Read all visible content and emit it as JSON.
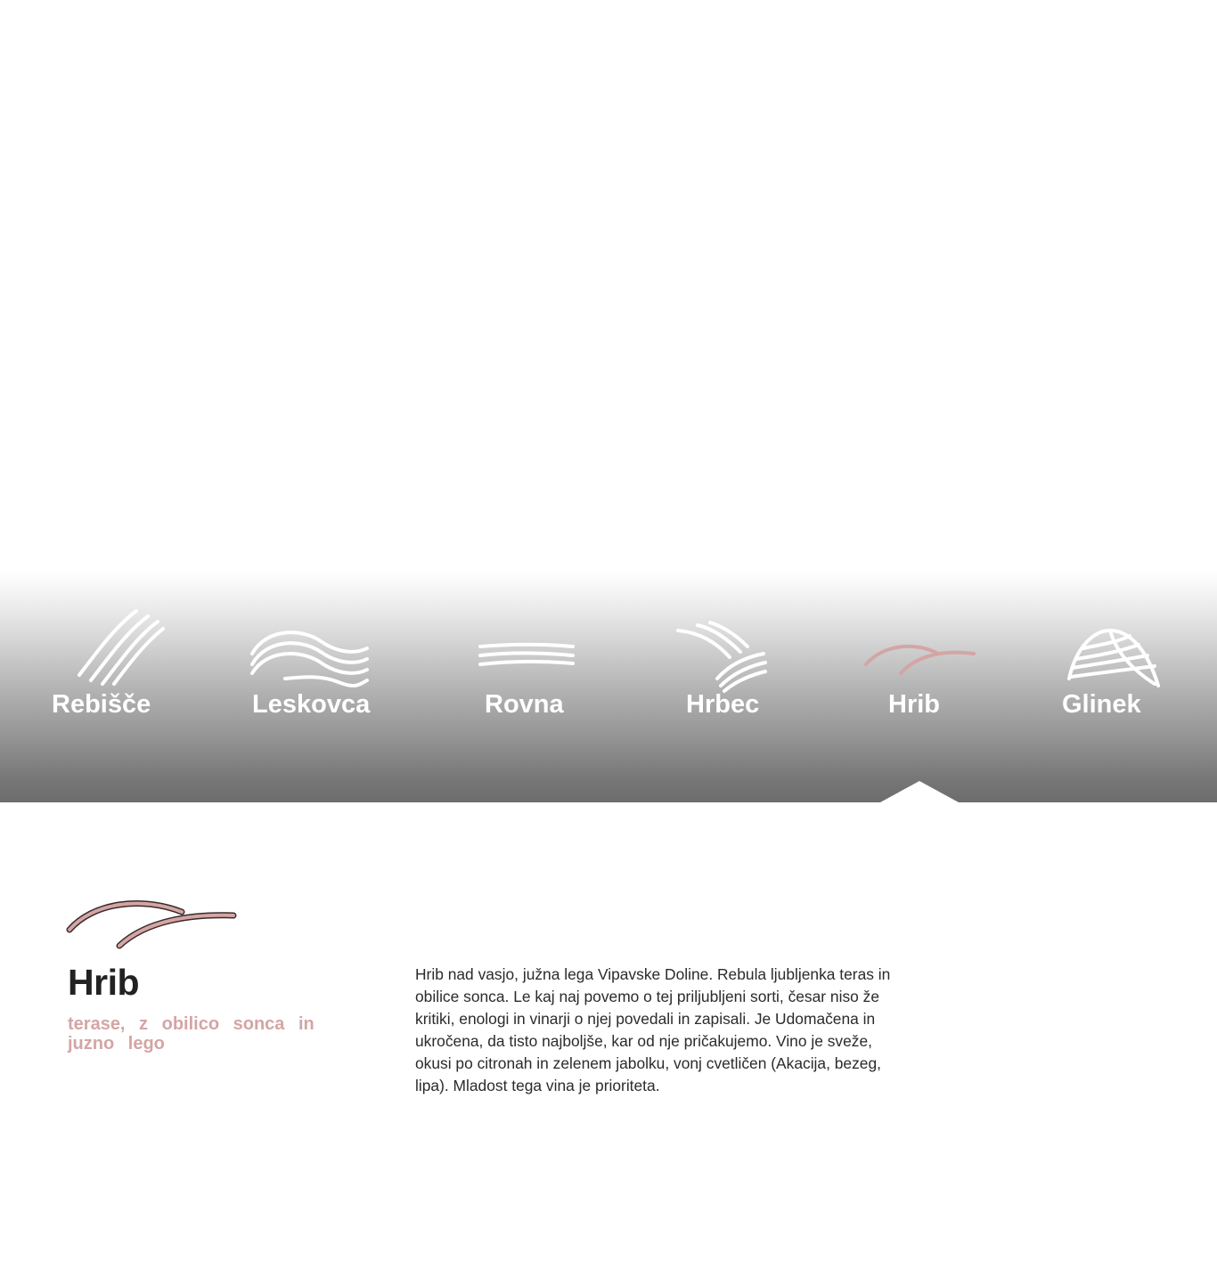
{
  "colors": {
    "accent": "#d4a5a5",
    "text_dark": "#222222",
    "tab_label": "#ffffff",
    "band_bottom": "#6c6c6c"
  },
  "tabs": [
    {
      "id": "rebisce",
      "label": "Rebišče",
      "icon": "diagonal-lines-icon",
      "active": false
    },
    {
      "id": "leskovca",
      "label": "Leskovca",
      "icon": "wave-lines-icon",
      "active": false
    },
    {
      "id": "rovna",
      "label": "Rovna",
      "icon": "flat-lines-icon",
      "active": false
    },
    {
      "id": "hrbec",
      "label": "Hrbec",
      "icon": "ridge-lines-icon",
      "active": false
    },
    {
      "id": "hrib",
      "label": "Hrib",
      "icon": "hill-arcs-icon",
      "active": true
    },
    {
      "id": "glinek",
      "label": "Glinek",
      "icon": "dome-hatch-icon",
      "active": false
    }
  ],
  "detail": {
    "icon": "hill-arcs-icon",
    "title": "Hrib",
    "subtitle": "terase, z obilico sonca in juzno lego",
    "description": "Hrib nad vasjo, južna lega Vipavske Doline. Rebula ljubljenka teras in obilice sonca. Le kaj naj povemo o tej priljubljeni sorti, česar niso že kritiki, enologi in vinarji o njej povedali in zapisali. Je Udomačena in ukročena, da tisto najboljše, kar od nje pričakujemo. Vino je sveže, okusi po citronah in zelenem jabolku, vonj cvetličen (Akacija, bezeg, lipa). Mladost tega vina je prioriteta."
  }
}
